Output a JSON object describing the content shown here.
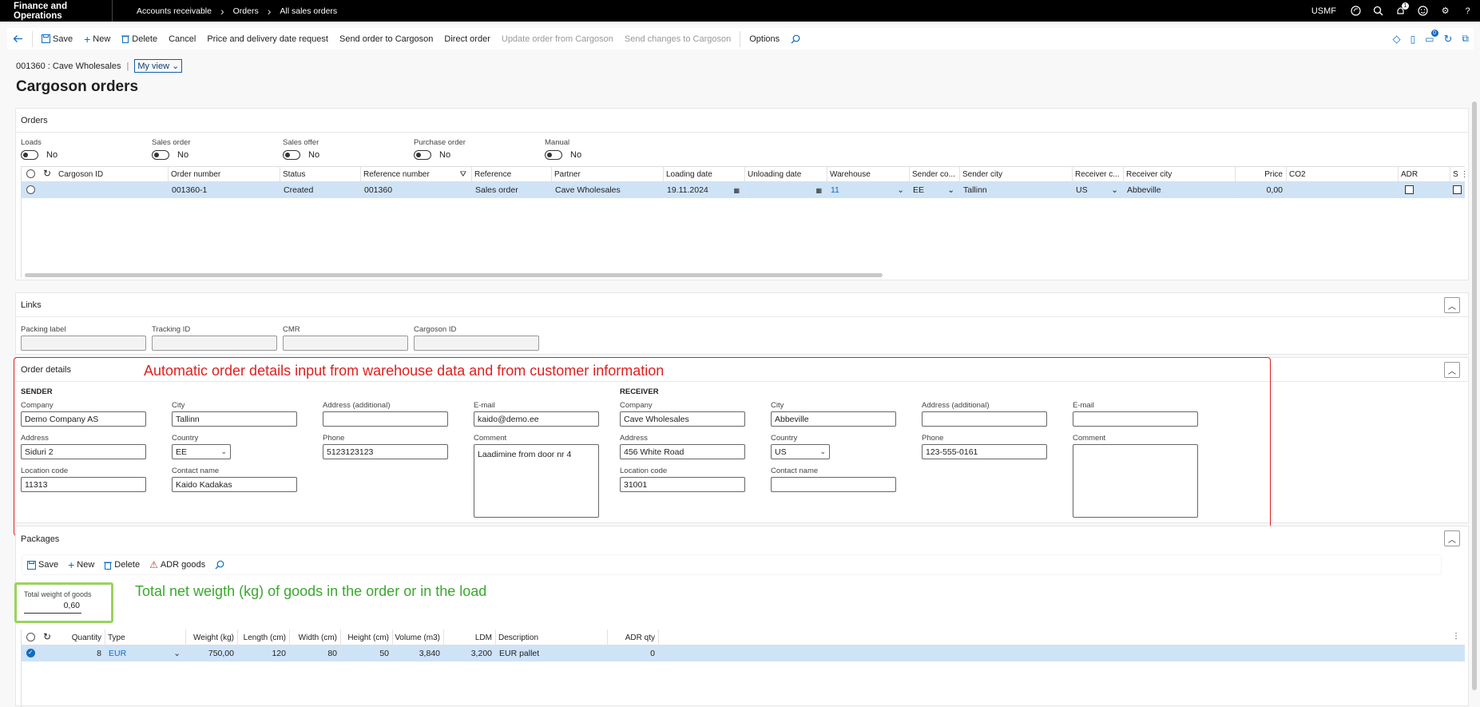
{
  "topbar": {
    "app": "Finance and Operations",
    "crumbs": [
      "Accounts receivable",
      "Orders",
      "All sales orders"
    ],
    "company": "USMF",
    "notif_count": "1"
  },
  "actions": {
    "save": "Save",
    "new": "New",
    "delete": "Delete",
    "cancel": "Cancel",
    "price_date": "Price and delivery date request",
    "send_order": "Send order to Cargoson",
    "direct_order": "Direct order",
    "update_order": "Update order from Cargoson",
    "send_changes": "Send changes to Cargoson",
    "options": "Options",
    "right_count": "0"
  },
  "header": {
    "record": "001360 : Cave Wholesales",
    "divider": "|",
    "view": "My view",
    "title": "Cargoson orders"
  },
  "orders": {
    "title": "Orders",
    "toggles": [
      {
        "label": "Loads",
        "value": "No"
      },
      {
        "label": "Sales order",
        "value": "No"
      },
      {
        "label": "Sales offer",
        "value": "No"
      },
      {
        "label": "Purchase order",
        "value": "No"
      },
      {
        "label": "Manual",
        "value": "No"
      }
    ],
    "columns": [
      "Cargoson ID",
      "Order number",
      "Status",
      "Reference number",
      "Reference",
      "Partner",
      "Loading date",
      "Unloading date",
      "Warehouse",
      "Sender co...",
      "Sender city",
      "Receiver c...",
      "Receiver city",
      "Price",
      "CO2",
      "ADR",
      "S"
    ],
    "row": {
      "cargoson_id": "",
      "order_number": "001360-1",
      "status": "Created",
      "reference_number": "001360",
      "reference": "Sales order",
      "partner": "Cave Wholesales",
      "loading_date": "19.11.2024",
      "unloading_date": "",
      "warehouse": "11",
      "sender_country": "EE",
      "sender_city": "Tallinn",
      "receiver_country": "US",
      "receiver_city": "Abbeville",
      "price": "0,00",
      "co2": ""
    }
  },
  "links": {
    "title": "Links",
    "fields": [
      {
        "label": "Packing label",
        "value": ""
      },
      {
        "label": "Tracking ID",
        "value": ""
      },
      {
        "label": "CMR",
        "value": ""
      },
      {
        "label": "Cargoson ID",
        "value": ""
      }
    ]
  },
  "details": {
    "title": "Order details",
    "annotation": "Automatic order details input from warehouse data and from customer information",
    "sender": {
      "heading": "SENDER",
      "company_label": "Company",
      "company": "Demo Company AS",
      "city_label": "City",
      "city": "Tallinn",
      "address2_label": "Address (additional)",
      "address2": "",
      "email_label": "E-mail",
      "email": "kaido@demo.ee",
      "address_label": "Address",
      "address": "Siduri 2",
      "country_label": "Country",
      "country": "EE",
      "phone_label": "Phone",
      "phone": "5123123123",
      "comment_label": "Comment",
      "comment": "Laadimine from door nr 4",
      "location_label": "Location code",
      "location": "11313",
      "contact_label": "Contact name",
      "contact": "Kaido Kadakas"
    },
    "receiver": {
      "heading": "RECEIVER",
      "company_label": "Company",
      "company": "Cave Wholesales",
      "city_label": "City",
      "city": "Abbeville",
      "address2_label": "Address (additional)",
      "address2": "",
      "email_label": "E-mail",
      "email": "",
      "address_label": "Address",
      "address": "456 White Road",
      "country_label": "Country",
      "country": "US",
      "phone_label": "Phone",
      "phone": "123-555-0161",
      "comment_label": "Comment",
      "comment": "",
      "location_label": "Location code",
      "location": "31001",
      "contact_label": "Contact name",
      "contact": ""
    }
  },
  "packages": {
    "title": "Packages",
    "save": "Save",
    "new": "New",
    "delete": "Delete",
    "adr": "ADR goods",
    "total_label": "Total weight of goods",
    "total": "0,60",
    "annotation": "Total net weigth (kg) of goods in the order or in the load",
    "columns": [
      "Quantity",
      "Type",
      "Weight (kg)",
      "Length (cm)",
      "Width (cm)",
      "Height (cm)",
      "Volume (m3)",
      "LDM",
      "Description",
      "ADR qty"
    ],
    "row": {
      "quantity": "8",
      "type": "EUR",
      "weight": "750,00",
      "length": "120",
      "width": "80",
      "height": "50",
      "volume": "3,840",
      "ldm": "3,200",
      "description": "EUR pallet",
      "adr_qty": "0"
    }
  }
}
